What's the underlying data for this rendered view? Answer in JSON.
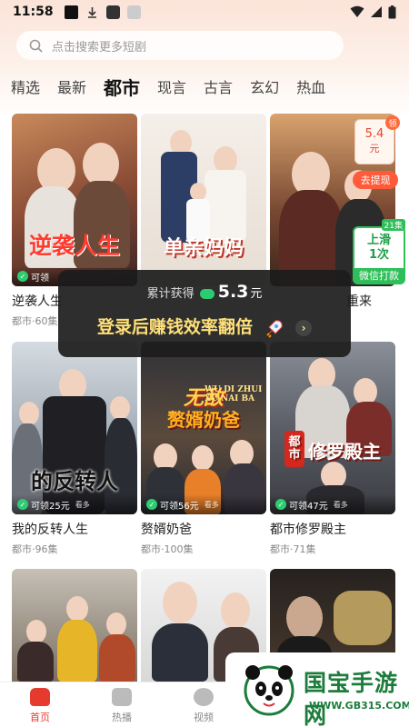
{
  "status_bar": {
    "time": "11:58"
  },
  "search": {
    "placeholder": "点击搜索更多短剧"
  },
  "tabs": [
    "精选",
    "最新",
    "都市",
    "现言",
    "古言",
    "玄幻",
    "热血"
  ],
  "active_tab": "都市",
  "dramas": [
    {
      "name": "逆袭人生",
      "meta": "都市·60集",
      "poster_text": "逆袭人生",
      "reward": "可领"
    },
    {
      "name": "",
      "meta": "",
      "poster_text": "单亲妈妈",
      "reward": ""
    },
    {
      "name": "",
      "meta": "",
      "poster_text": "",
      "reward": ""
    },
    {
      "name": "我的反转人生",
      "meta": "都市·96集",
      "poster_text": "的反转人",
      "reward": "可领25元",
      "more": "看多"
    },
    {
      "name": "赘婿奶爸",
      "meta": "都市·100集",
      "poster_text": "赘婿奶爸",
      "poster_sub": "无敌",
      "poster_en": "WU DI ZHUI XU NAI BA",
      "reward": "可领56元",
      "more": "看多"
    },
    {
      "name": "都市修罗殿主",
      "meta": "都市·71集",
      "poster_text": "修罗殿主",
      "poster_badge": "都市",
      "reward": "可领47元",
      "more": "看多"
    }
  ],
  "third_title_partial": "重来",
  "popup": {
    "earned_label": "累计获得",
    "amount": "5.3",
    "unit": "元",
    "cta": "登录后赚钱效率翻倍"
  },
  "coupon": {
    "amount": "5.4",
    "unit": "元",
    "tag": "领",
    "withdraw": "去提现"
  },
  "swipe_widget": {
    "badge": "21集",
    "line1": "上滑",
    "line2": "1次",
    "action": "微信打款"
  },
  "nav": [
    {
      "label": "首页",
      "icon": "home-icon"
    },
    {
      "label": "热播",
      "icon": "play-icon"
    },
    {
      "label": "视频",
      "icon": "video-icon"
    }
  ],
  "watermark": {
    "text": "国宝手游网",
    "url": "WWW.GB315.COM"
  },
  "colors": {
    "accent": "#e63a2e",
    "popup_cta": "#ffe07a",
    "green": "#2ecc71"
  }
}
